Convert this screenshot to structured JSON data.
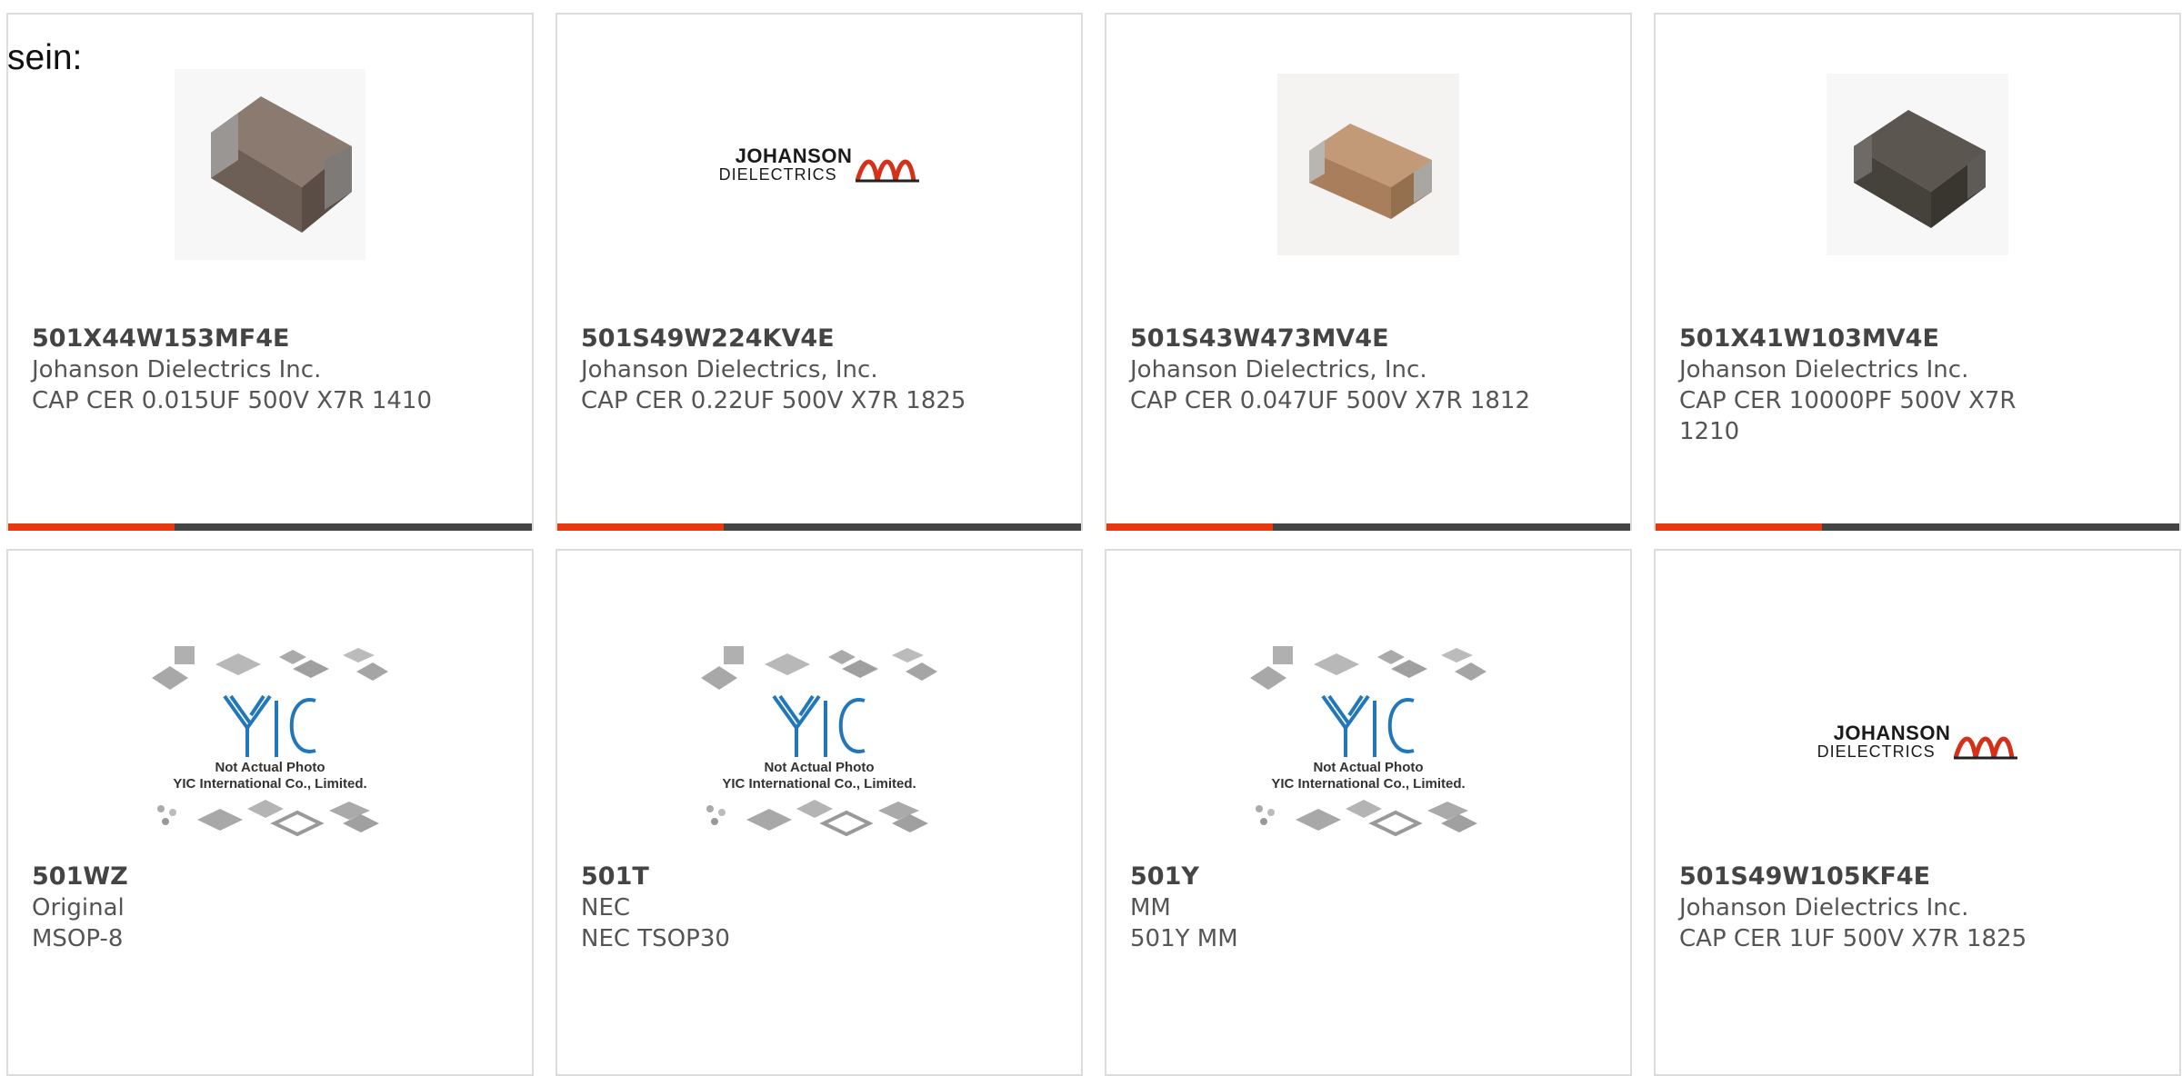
{
  "intro_text": "sein:",
  "colors": {
    "accent": "#e8380d",
    "bar_dark": "#444444",
    "card_border": "#dcdcdc"
  },
  "products": [
    {
      "part_number": "501X44W153MF4E",
      "manufacturer": "Johanson Dielectrics Inc.",
      "description": "CAP CER 0.015UF 500V X7R 1410",
      "image": "capacitor-chip-image"
    },
    {
      "part_number": "501S49W224KV4E",
      "manufacturer": "Johanson Dielectrics, Inc.",
      "description": "CAP CER 0.22UF 500V X7R 1825",
      "image": "johanson-logo"
    },
    {
      "part_number": "501S43W473MV4E",
      "manufacturer": "Johanson Dielectrics, Inc.",
      "description": "CAP CER 0.047UF 500V X7R 1812",
      "image": "capacitor-chip-image"
    },
    {
      "part_number": "501X41W103MV4E",
      "manufacturer": "Johanson Dielectrics Inc.",
      "description_lines": [
        "CAP CER 10000PF 500V X7R",
        "1210"
      ],
      "image": "capacitor-chip-image"
    },
    {
      "part_number": "501WZ",
      "manufacturer": "Original",
      "description": "MSOP-8",
      "image": "yic-placeholder"
    },
    {
      "part_number": "501T",
      "manufacturer": "NEC",
      "description": "NEC TSOP30",
      "image": "yic-placeholder"
    },
    {
      "part_number": "501Y",
      "manufacturer": "MM",
      "description": "501Y MM",
      "image": "yic-placeholder"
    },
    {
      "part_number": "501S49W105KF4E",
      "manufacturer": "Johanson Dielectrics Inc.",
      "description": "CAP CER 1UF 500V X7R 1825",
      "image": "johanson-logo"
    }
  ],
  "johanson_logo": {
    "line1": "JOHANSON",
    "line2": "DIELECTRICS"
  },
  "yic_placeholder": {
    "brand": "YIC",
    "caption_line1": "Not Actual Photo",
    "caption_line2": "YIC International Co., Limited."
  }
}
